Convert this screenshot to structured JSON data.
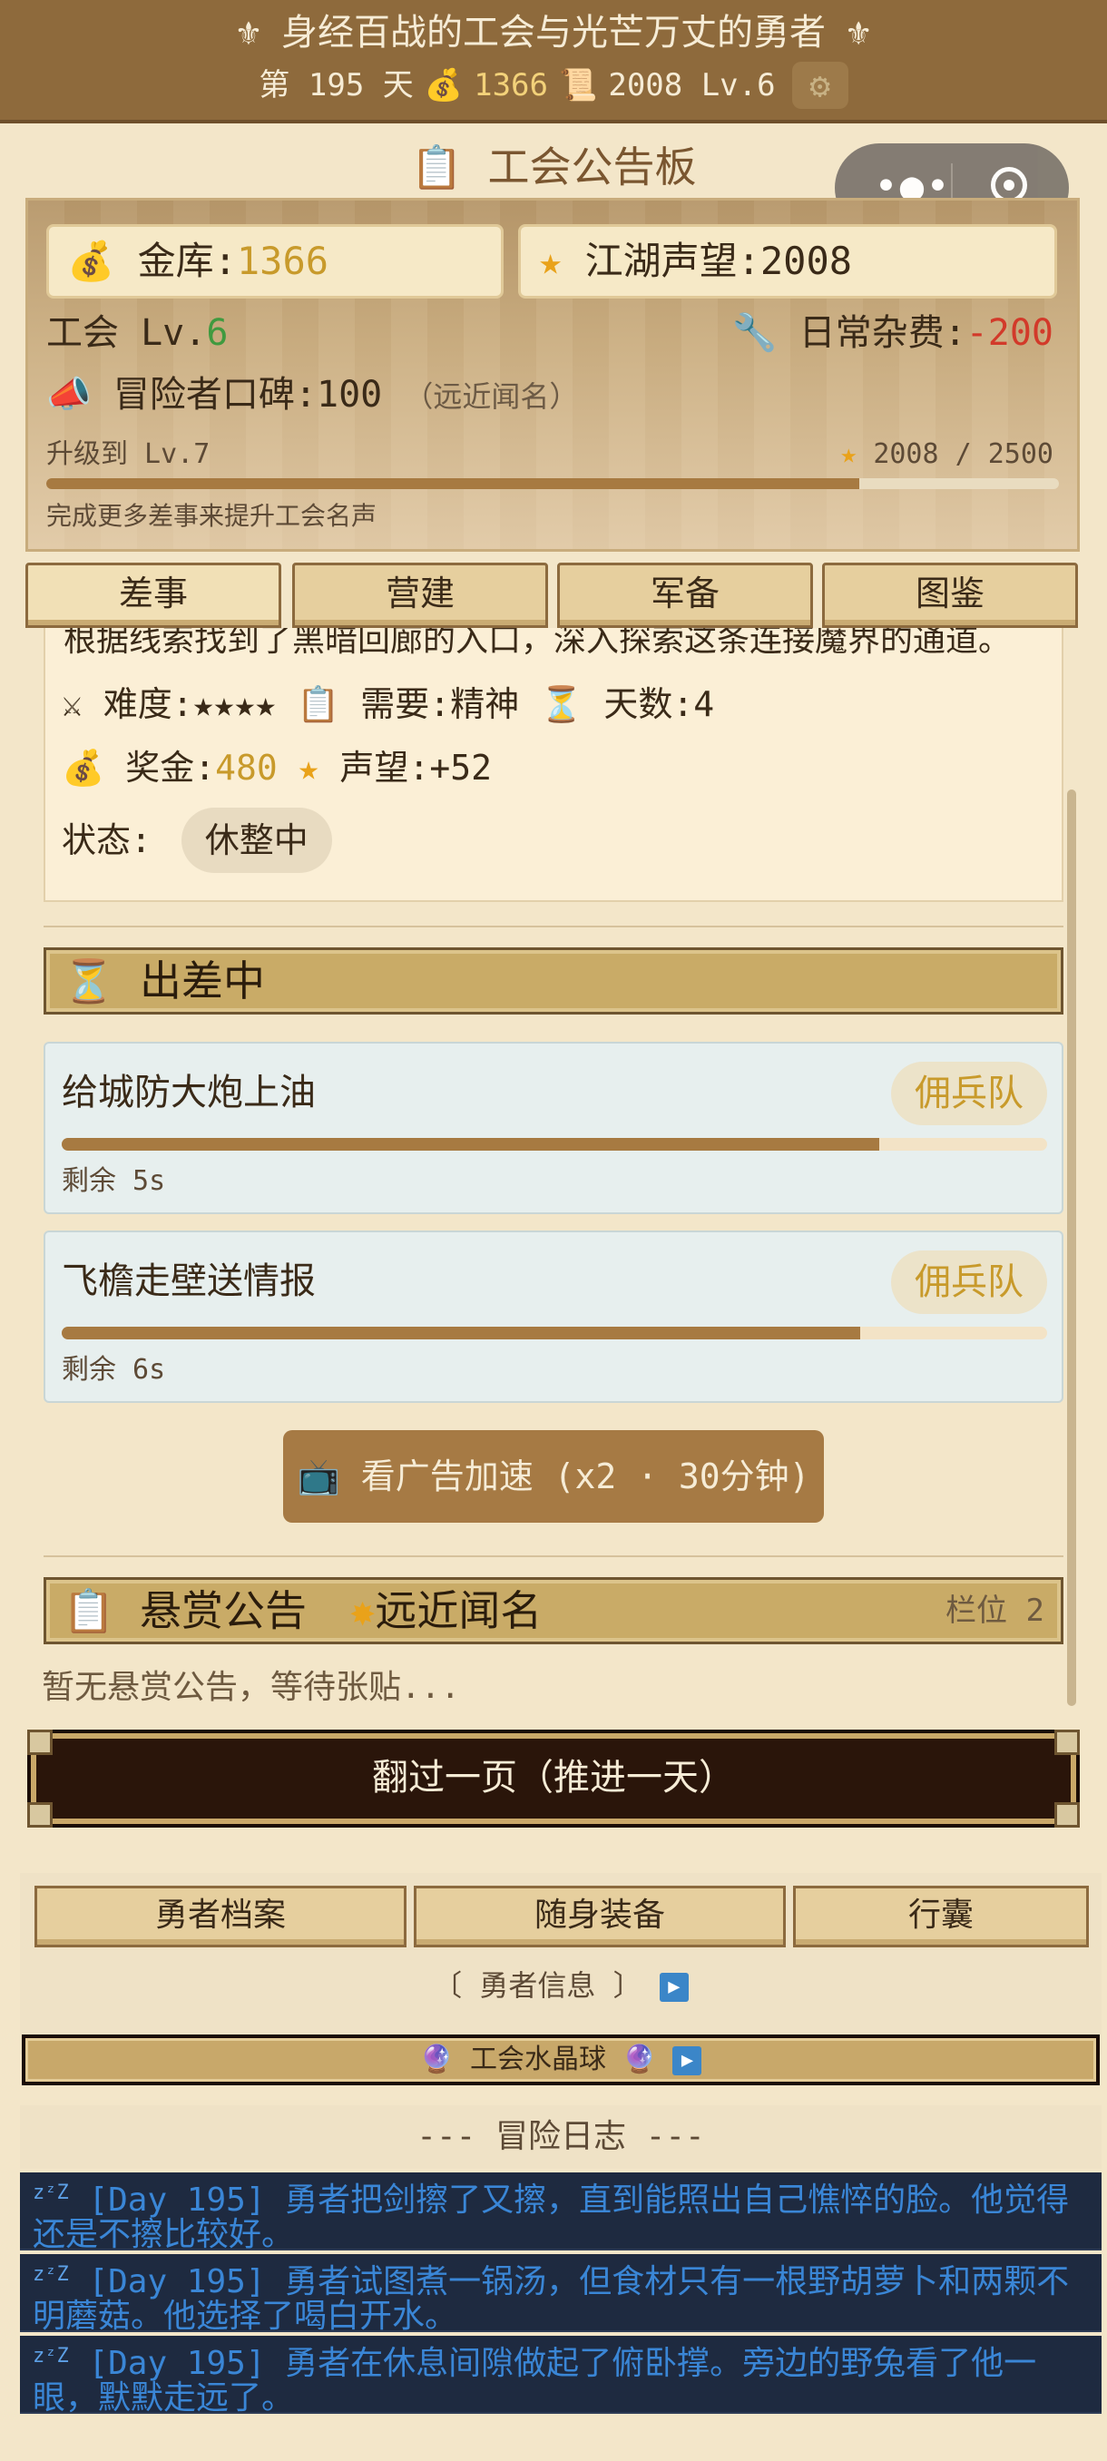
{
  "header": {
    "title": "⚜ 身经百战的工会与光芒万丈的勇者 ⚜",
    "day_label": "第 195 天",
    "gold": "1366",
    "renown": "2008 Lv.6",
    "settings_icon": "gear-icon"
  },
  "board": {
    "title": "📋 工会公告板",
    "treasury_label": "金库:",
    "treasury_value": "1366",
    "reputation_label": "江湖声望:",
    "reputation_value": "2008",
    "guild_level_label": "工会 Lv.",
    "guild_level_value": "6",
    "daily_cost_label": "日常杂费:",
    "daily_cost_value": "-200",
    "wom_label": "冒险者口碑:",
    "wom_value": "100",
    "wom_rank": "（远近闻名）",
    "upgrade_label": "升级到 Lv.7",
    "upgrade_count": "2008 / 2500",
    "upgrade_progress": 0.8032,
    "upgrade_hint": "完成更多差事来提升工会名声"
  },
  "tabs": [
    "差事",
    "营建",
    "军备",
    "图鉴"
  ],
  "quest": {
    "description": "根据线索找到了黑暗回廊的入口，深入探索这条连接魔界的通道。",
    "difficulty_label": "难度:",
    "difficulty_value": "★★★★",
    "need_label": "需要:",
    "need_value": "精神",
    "days_label": "天数:",
    "days_value": "4",
    "reward_label": "奖金:",
    "reward_value": "480",
    "rep_label": "声望:",
    "rep_value": "+52",
    "status_label": "状态:",
    "status_value": "休整中"
  },
  "ongoing": {
    "title": "出差中",
    "missions": [
      {
        "name": "给城防大炮上油",
        "tag": "佣兵队",
        "remaining": "剩余 5s",
        "progress": 0.83
      },
      {
        "name": "飞檐走壁送情报",
        "tag": "佣兵队",
        "remaining": "剩余 6s",
        "progress": 0.81
      }
    ],
    "ad_button": "看广告加速 (x2 · 30分钟)"
  },
  "bounty": {
    "title": "悬赏公告",
    "fame": "远近闻名",
    "slots": "栏位 2",
    "empty": "暂无悬赏公告，等待张贴..."
  },
  "next_day": "翻过一页（推进一天）",
  "hero_tabs": [
    "勇者档案",
    "随身装备",
    "行囊"
  ],
  "hero_info": "勇者信息",
  "crystal": "工会水晶球",
  "log": {
    "title": "--- 冒险日志 ---",
    "entries": [
      "[Day 195] 勇者把剑擦了又擦，直到能照出自己憔悴的脸。他觉得还是不擦比较好。",
      "[Day 195] 勇者试图煮一锅汤，但食材只有一根野胡萝卜和两颗不明蘑菇。他选择了喝白开水。",
      "[Day 195] 勇者在休息间隙做起了俯卧撑。旁边的野兔看了他一眼，默默走远了。"
    ]
  },
  "colors": {
    "header_bg": "#8e6a3c",
    "accent_gold": "#c89a2b",
    "log_bg": "#1e2a40",
    "log_text": "#3a86d6"
  }
}
